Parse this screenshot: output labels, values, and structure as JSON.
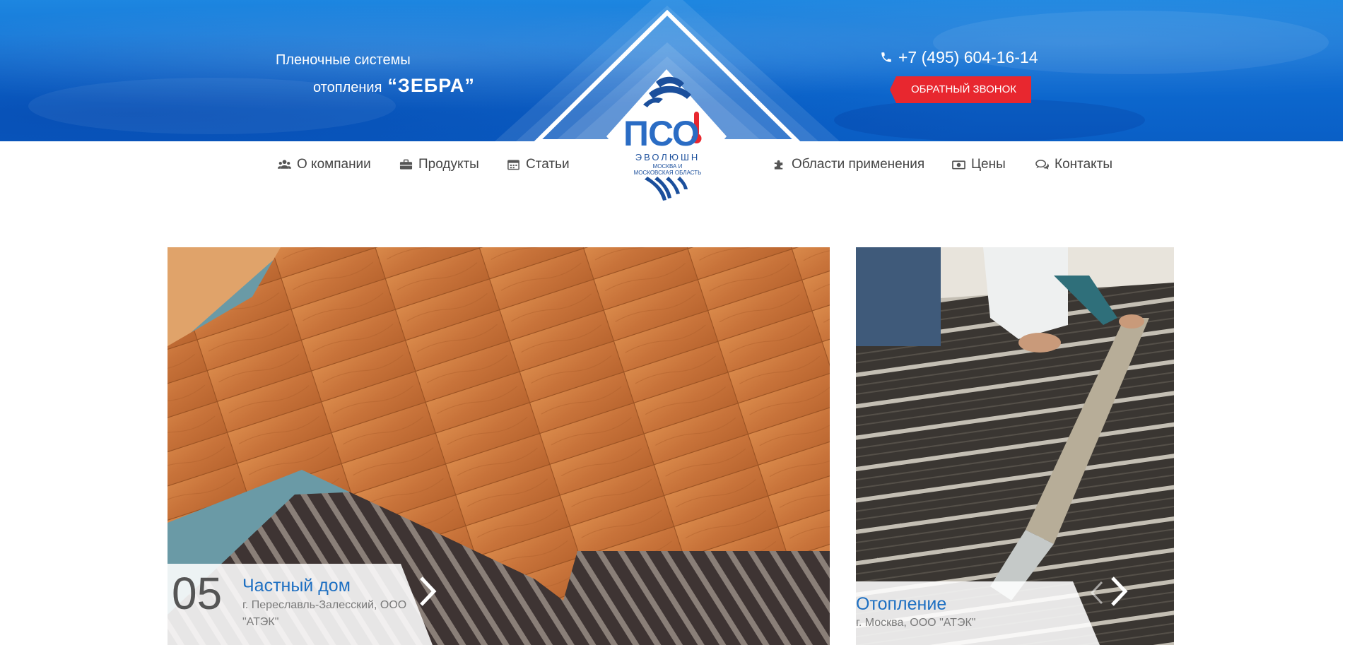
{
  "header": {
    "tagline_line1": "Пленочные системы",
    "tagline_line2_prefix": "отопления",
    "tagline_brand": "“ЗЕБРА”",
    "phone": "+7 (495) 604-16-14",
    "callback_button": "ОБРАТНЫЙ ЗВОНОК"
  },
  "logo": {
    "mark": "ПСО",
    "brand": "ЭВОЛЮШН",
    "region_line1": "МОСКВА И",
    "region_line2": "МОСКОВСКАЯ ОБЛАСТЬ"
  },
  "nav": {
    "items": [
      {
        "label": "О компании",
        "icon": "users-icon"
      },
      {
        "label": "Продукты",
        "icon": "briefcase-icon"
      },
      {
        "label": "Статьи",
        "icon": "calendar-icon"
      },
      {
        "label": "Области применения",
        "icon": "puzzle-icon"
      },
      {
        "label": "Цены",
        "icon": "money-icon"
      },
      {
        "label": "Контакты",
        "icon": "comments-icon"
      }
    ]
  },
  "gallery": {
    "main": {
      "number": "05",
      "title": "Частный дом",
      "subtitle": "г. Переславль-Залесский, ООО \"АТЭК\""
    },
    "side": {
      "title": "Отопление",
      "subtitle": "г. Москва, ООО \"АТЭК\""
    }
  },
  "colors": {
    "header_blue": "#0d6ad0",
    "callback_red": "#e8272f",
    "nav_text": "#444444",
    "caption_title": "#1d6fc2"
  }
}
